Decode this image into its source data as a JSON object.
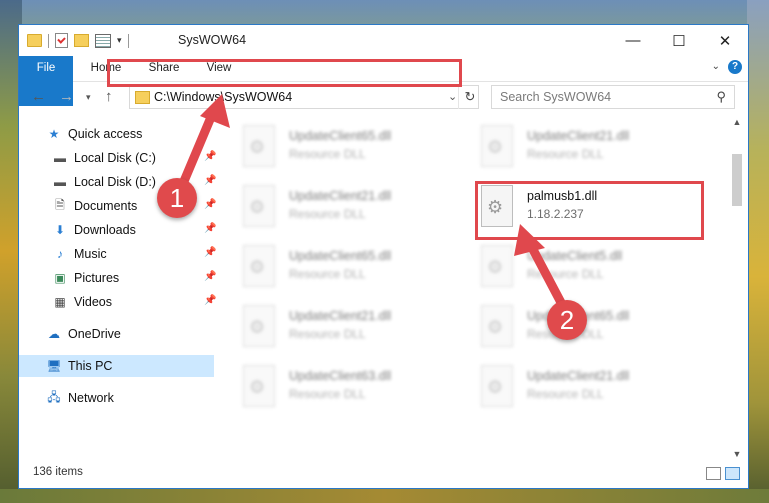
{
  "window": {
    "title": "SysWOW64",
    "controls": {
      "minimize": "—",
      "maximize": "☐",
      "close": "✕"
    }
  },
  "ribbon": {
    "tabs": [
      "File",
      "Home",
      "Share",
      "View"
    ],
    "help": "?"
  },
  "address": {
    "path": "C:\\Windows\\SysWOW64",
    "search_placeholder": "Search SysWOW64"
  },
  "sidebar": {
    "items": [
      {
        "label": "Quick access",
        "icon": "star-icon"
      },
      {
        "label": "Local Disk (C:)",
        "icon": "drive-icon",
        "pinned": true
      },
      {
        "label": "Local Disk (D:)",
        "icon": "drive-icon",
        "pinned": true
      },
      {
        "label": "Documents",
        "icon": "documents-icon",
        "pinned": true
      },
      {
        "label": "Downloads",
        "icon": "download-icon",
        "pinned": true
      },
      {
        "label": "Music",
        "icon": "music-icon",
        "pinned": true
      },
      {
        "label": "Pictures",
        "icon": "pictures-icon",
        "pinned": true
      },
      {
        "label": "Videos",
        "icon": "videos-icon",
        "pinned": true
      },
      {
        "label": "OneDrive",
        "icon": "cloud-icon"
      },
      {
        "label": "This PC",
        "icon": "pc-icon",
        "selected": true
      },
      {
        "label": "Network",
        "icon": "network-icon"
      }
    ]
  },
  "files": [
    {
      "name": "UpdateClient65.dll",
      "desc": "Resource DLL"
    },
    {
      "name": "UpdateClient21.dll",
      "desc": "Resource DLL"
    },
    {
      "name": "UpdateClient21.dll",
      "desc": "Resource DLL"
    },
    {
      "name": "palmusb1.dll",
      "desc": "1.18.2.237",
      "highlighted": true
    },
    {
      "name": "UpdateClient65.dll",
      "desc": "Resource DLL"
    },
    {
      "name": "UpdateClient5.dll",
      "desc": "Resource DLL"
    },
    {
      "name": "UpdateClient21.dll",
      "desc": "Resource DLL"
    },
    {
      "name": "UpdateClient65.dll",
      "desc": "Resource DLL"
    },
    {
      "name": "UpdateClient63.dll",
      "desc": "Resource DLL"
    },
    {
      "name": "UpdateClient21.dll",
      "desc": "Resource DLL"
    }
  ],
  "status": {
    "count": "136 items"
  },
  "annotations": {
    "step1": "1",
    "step2": "2",
    "color": "#e0484d"
  }
}
